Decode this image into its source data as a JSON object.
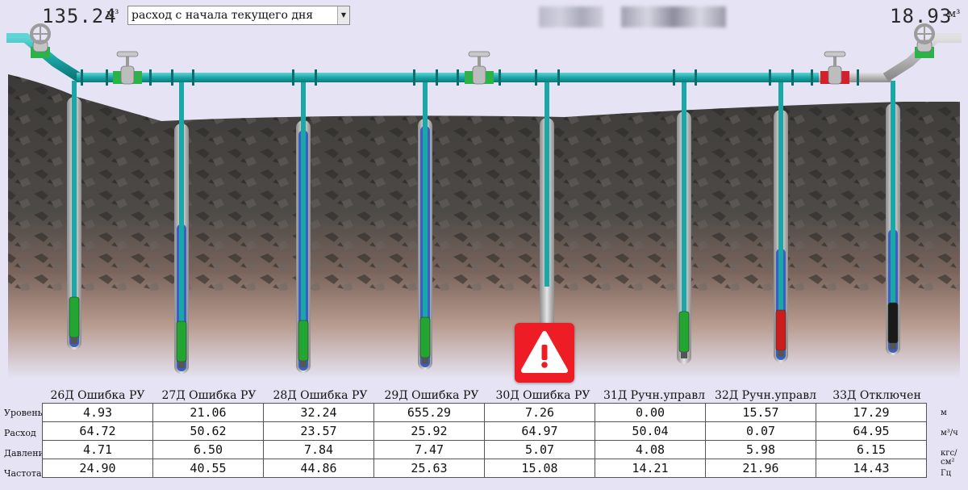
{
  "header": {
    "total_volume": "135.24",
    "total_volume_unit": "м³",
    "period_select": "расход с начала текущего дня",
    "right_volume": "18.93",
    "right_volume_unit": "м³"
  },
  "wells": [
    {
      "title": "26Д Ошибка РУ",
      "level": 0.1,
      "pump_color": "#22a531"
    },
    {
      "title": "27Д Ошибка РУ",
      "level": 0.6,
      "pump_color": "#22a531"
    },
    {
      "title": "28Д Ошибка РУ",
      "level": 0.97,
      "pump_color": "#22a531"
    },
    {
      "title": "29Д Ошибка РУ",
      "level": 0.98,
      "pump_color": "#22a531"
    },
    {
      "title": "30Д Ошибка РУ",
      "level": 0.0,
      "pump_color": "#22a531"
    },
    {
      "title": "31Д Ручн.управл",
      "level": 0.0,
      "pump_color": "#22a531"
    },
    {
      "title": "32Д Ручн.управл",
      "level": 0.45,
      "pump_color": "#cc1d1d"
    },
    {
      "title": "33Д Отключен",
      "level": 0.5,
      "pump_color": "#1a1a1a"
    }
  ],
  "table": {
    "rows": [
      {
        "label": "Уровень",
        "unit": "м",
        "values": [
          "4.93",
          "21.06",
          "32.24",
          "655.29",
          "7.26",
          "0.00",
          "15.57",
          "17.29"
        ]
      },
      {
        "label": "Расход",
        "unit": "м³/ч",
        "values": [
          "64.72",
          "50.62",
          "23.57",
          "25.92",
          "64.97",
          "50.04",
          "0.07",
          "64.95"
        ]
      },
      {
        "label": "Давление",
        "unit": "кгс/см²",
        "values": [
          "4.71",
          "6.50",
          "7.84",
          "7.47",
          "5.07",
          "4.08",
          "5.98",
          "6.15"
        ]
      },
      {
        "label": "Частота",
        "unit": "Гц",
        "values": [
          "24.90",
          "40.55",
          "44.86",
          "25.63",
          "15.08",
          "14.21",
          "21.96",
          "14.43"
        ]
      }
    ]
  },
  "colors": {
    "pipe": "#1aa7a7",
    "water": "#3b5ec4",
    "valve_open": "#2bb34a",
    "valve_closed": "#d4202a",
    "alarm": "#ee1c25"
  },
  "icons": {
    "alarm": "warning-icon",
    "valve": "valve-icon",
    "pump": "pump-icon"
  }
}
